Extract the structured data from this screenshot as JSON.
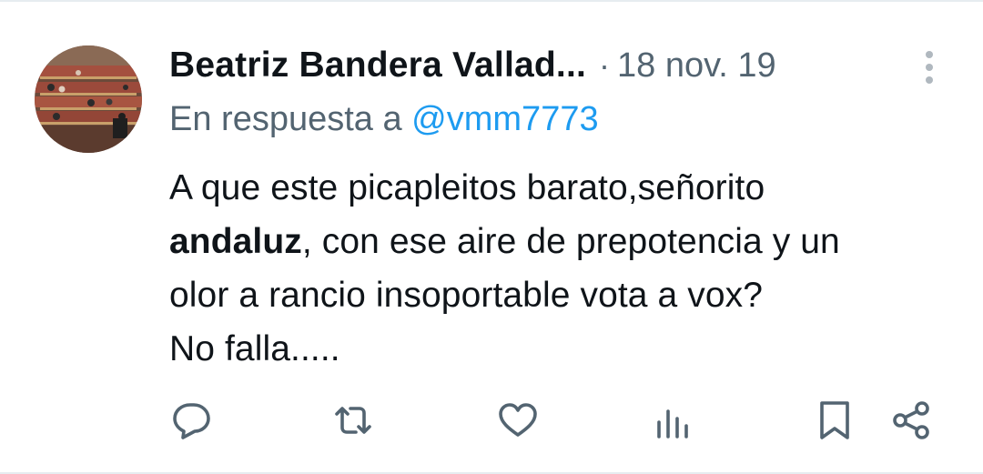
{
  "tweet": {
    "author_name": "Beatriz Bandera Vallad...",
    "separator": "·",
    "timestamp": "18 nov. 19",
    "reply_prefix": "En respuesta a",
    "reply_handle": "@vmm7773",
    "body": {
      "line1": "A que este picapleitos barato,señorito",
      "line2_bold": "andaluz",
      "line2_rest": ", con ese aire de prepotencia y un",
      "line3": "olor a rancio insoportable vota a vox?",
      "line4": "No falla....."
    }
  },
  "actions": [
    {
      "icon": "reply-icon"
    },
    {
      "icon": "retweet-icon"
    },
    {
      "icon": "like-icon"
    },
    {
      "icon": "views-icon"
    },
    {
      "icon": "bookmark-icon"
    },
    {
      "icon": "share-icon"
    }
  ],
  "colors": {
    "text": "#0f1419",
    "secondary": "#536471",
    "accent": "#1d9bf0",
    "divider": "#e6ecf0"
  }
}
